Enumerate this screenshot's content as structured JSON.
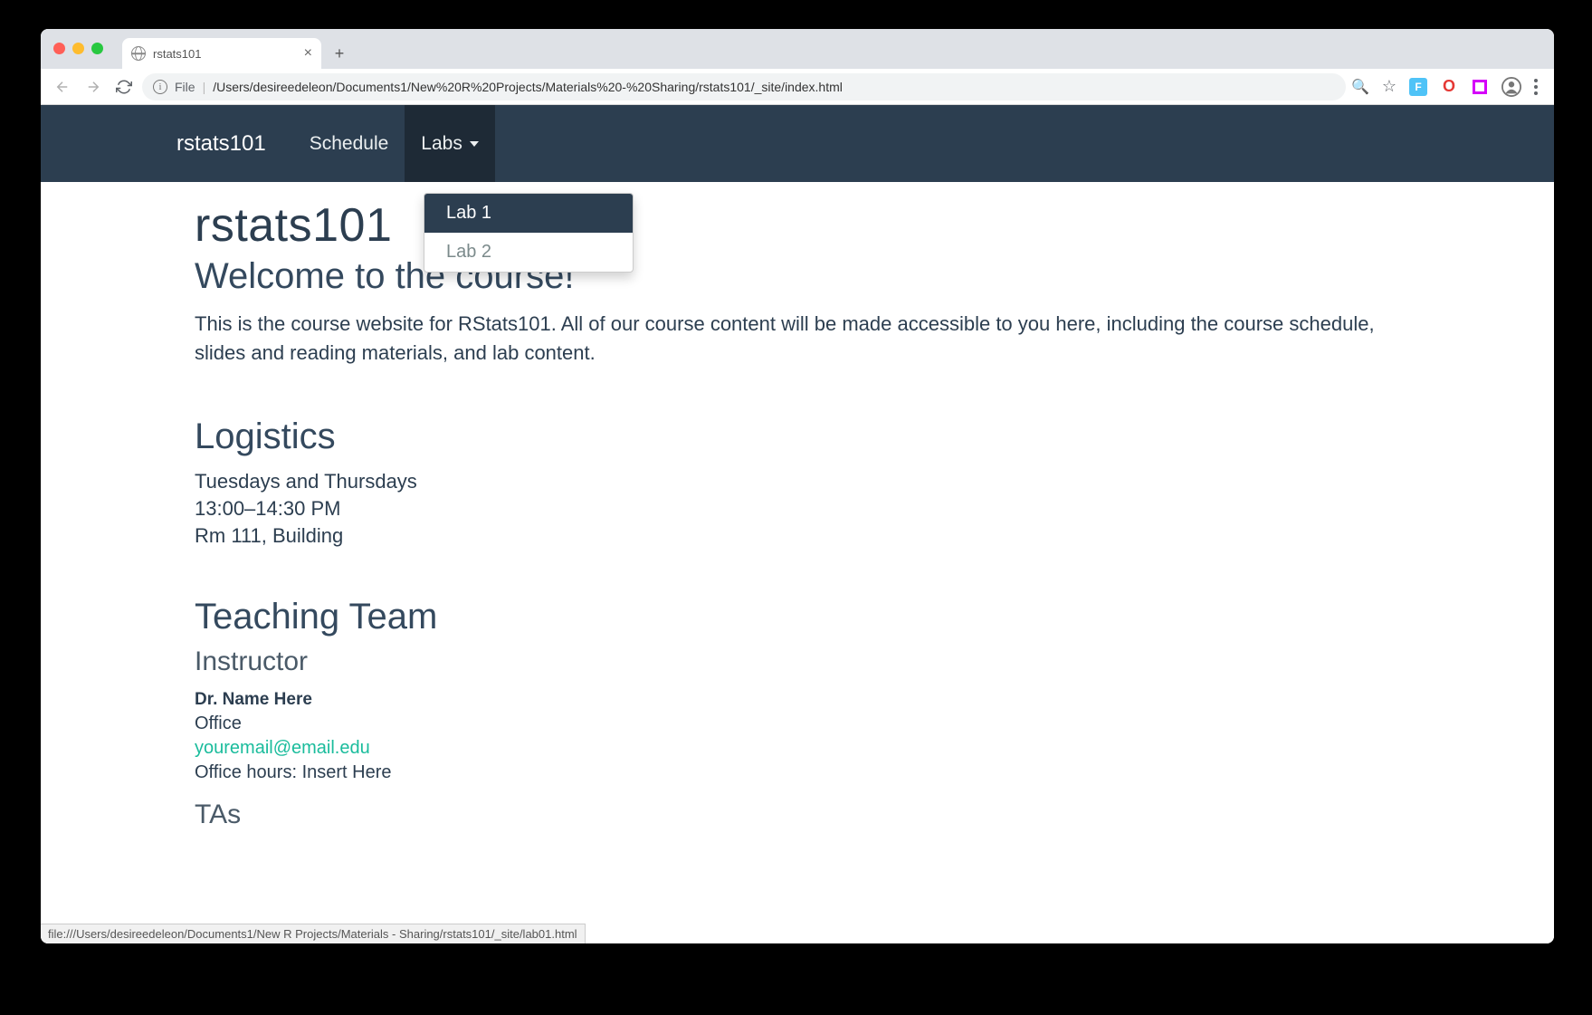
{
  "browser": {
    "tab_title": "rstats101",
    "url_label": "File",
    "url_path": "/Users/desireedeleon/Documents1/New%20R%20Projects/Materials%20-%20Sharing/rstats101/_site/index.html",
    "status_bar": "file:///Users/desireedeleon/Documents1/New R Projects/Materials - Sharing/rstats101/_site/lab01.html"
  },
  "navbar": {
    "brand": "rstats101",
    "items": [
      {
        "label": "Schedule",
        "has_dropdown": false
      },
      {
        "label": "Labs",
        "has_dropdown": true
      }
    ],
    "dropdown": [
      {
        "label": "Lab 1",
        "highlighted": true
      },
      {
        "label": "Lab 2",
        "highlighted": false
      }
    ]
  },
  "page": {
    "title": "rstats101",
    "welcome_heading": "Welcome to the course!",
    "intro": "This is the course website for RStats101. All of our course content will be made accessible to you here, including the course schedule, slides and reading materials, and lab content.",
    "logistics_heading": "Logistics",
    "logistics_lines": [
      "Tuesdays and Thursdays",
      "13:00–14:30 PM",
      "Rm 111, Building"
    ],
    "team_heading": "Teaching Team",
    "instructor_heading": "Instructor",
    "instructor_name": "Dr. Name Here",
    "instructor_office": "Office",
    "instructor_email": "youremail@email.edu",
    "instructor_hours": "Office hours: Insert Here",
    "tas_heading": "TAs"
  }
}
